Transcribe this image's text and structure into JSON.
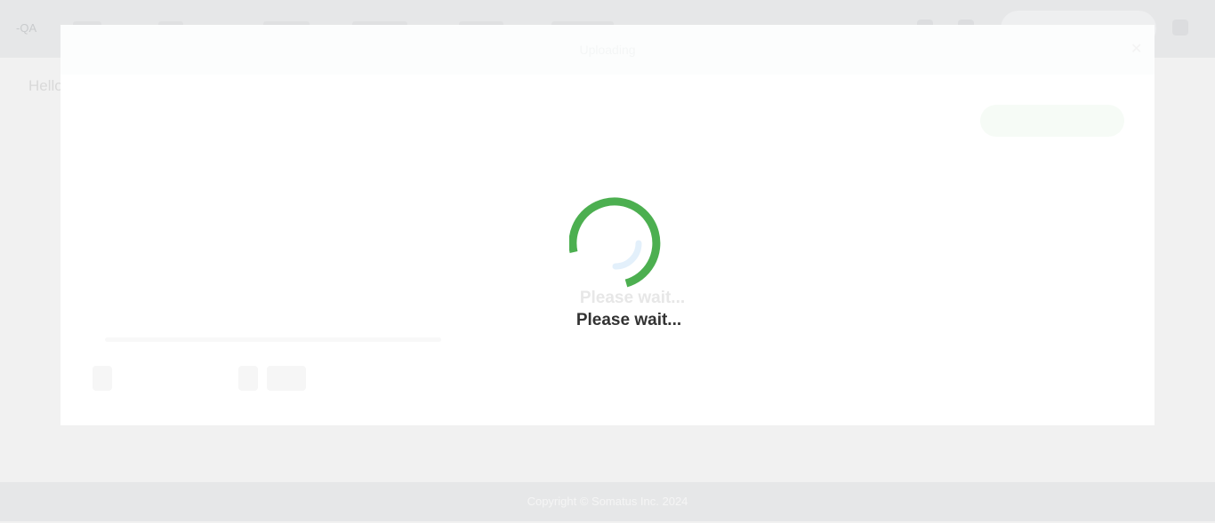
{
  "app": {
    "brand": "-QA"
  },
  "page": {
    "greeting": "Hello"
  },
  "modal": {
    "title": "Uploading",
    "close_icon": "close-icon"
  },
  "loader": {
    "primary_text": "Please wait...",
    "ghost_text": "Please wait...",
    "spinner_color": "#4caf50",
    "spinner_trail_color": "#e3f0fb"
  },
  "footer": {
    "copyright": "Copyright © Somatus Inc. 2024"
  },
  "colors": {
    "overlay_bg": "#f1f1f1",
    "topbar_bg": "#e6e7e8",
    "modal_bg": "#ffffff"
  }
}
